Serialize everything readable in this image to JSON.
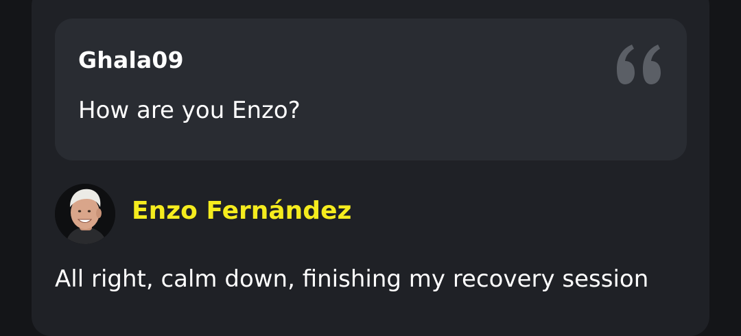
{
  "question": {
    "username": "Ghala09",
    "text": "How are you Enzo?",
    "icon": "quote-icon"
  },
  "answer": {
    "avatar_icon": "player-avatar",
    "name": "Enzo Fernández",
    "text": "All right, calm down, finishing my recovery session"
  },
  "colors": {
    "page_background": "#141518",
    "card_background": "#1f2126",
    "bubble_background": "#292c32",
    "name_accent": "#f5ec1e",
    "text": "#ffffff",
    "quote_mark": "#5b5f66"
  }
}
